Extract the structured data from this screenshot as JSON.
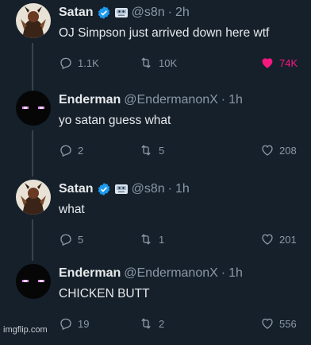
{
  "colors": {
    "background": "#15202b",
    "verified": "#1d9bf0",
    "like_active": "#f91880",
    "muted": "#8b98a5"
  },
  "tweets": [
    {
      "name": "Satan",
      "verified": true,
      "extra_badge_icon": "bot-label-icon",
      "handle": "@s8n",
      "time": "2h",
      "text": "OJ Simpson just arrived down here wtf",
      "replies": "1.1K",
      "retweets": "10K",
      "likes": "74K",
      "liked": true,
      "avatar_icon": "satan-avatar"
    },
    {
      "name": "Enderman",
      "verified": false,
      "handle": "@EndermanonX",
      "time": "1h",
      "text": "yo satan guess what",
      "replies": "2",
      "retweets": "5",
      "likes": "208",
      "liked": false,
      "avatar_icon": "enderman-avatar"
    },
    {
      "name": "Satan",
      "verified": true,
      "extra_badge_icon": "bot-label-icon",
      "handle": "@s8n",
      "time": "1h",
      "text": "what",
      "replies": "5",
      "retweets": "1",
      "likes": "201",
      "liked": false,
      "avatar_icon": "satan-avatar"
    },
    {
      "name": "Enderman",
      "verified": false,
      "handle": "@EndermanonX",
      "time": "1h",
      "text": "CHICKEN BUTT",
      "replies": "19",
      "retweets": "2",
      "likes": "556",
      "liked": false,
      "avatar_icon": "enderman-avatar"
    }
  ],
  "separator": "·",
  "watermark": "imgflip.com"
}
